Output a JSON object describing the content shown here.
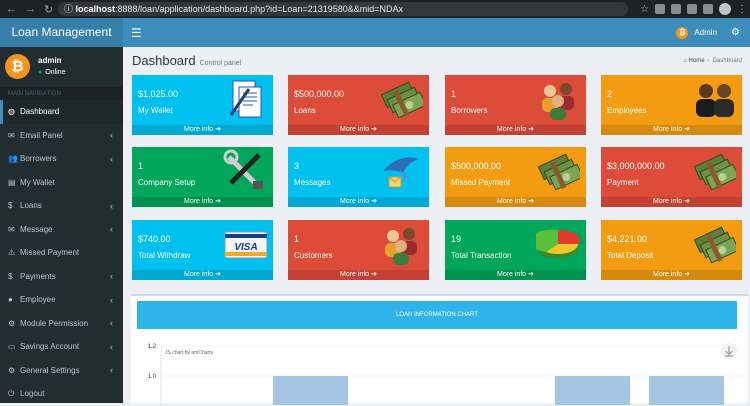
{
  "browser": {
    "url_host": "localhost",
    "url_rest": ":8888/loan/application/dashboard.php?id=Loan=21319580&&mid=NDAx"
  },
  "app": {
    "title": "Loan Management"
  },
  "topbar": {
    "user_name": "Admin",
    "coin_letter": "₿"
  },
  "sidebar": {
    "user": {
      "name": "admin",
      "status": "Online",
      "coin_letter": "₿"
    },
    "header": "MAIN NAVIGATION",
    "items": [
      {
        "label": "Dashboard",
        "icon": "dashboard-icon",
        "has_submenu": false,
        "active": true
      },
      {
        "label": "Email Panel",
        "icon": "envelope-icon",
        "has_submenu": true
      },
      {
        "label": "Borrowers",
        "icon": "users-icon",
        "has_submenu": true
      },
      {
        "label": "My Wallet",
        "icon": "wallet-icon",
        "has_submenu": false
      },
      {
        "label": "Loans",
        "icon": "dollar-icon",
        "has_submenu": true
      },
      {
        "label": "Message",
        "icon": "message-icon",
        "has_submenu": true
      },
      {
        "label": "Missed Payment",
        "icon": "warning-icon",
        "has_submenu": false
      },
      {
        "label": "Payments",
        "icon": "payment-icon",
        "has_submenu": true
      },
      {
        "label": "Employee",
        "icon": "user-icon",
        "has_submenu": true
      },
      {
        "label": "Module Permission",
        "icon": "gears-icon",
        "has_submenu": true
      },
      {
        "label": "Savings Account",
        "icon": "savings-icon",
        "has_submenu": true
      },
      {
        "label": "General Settings",
        "icon": "settings-icon",
        "has_submenu": true
      },
      {
        "label": "Logout",
        "icon": "logout-icon",
        "has_submenu": false
      }
    ]
  },
  "page": {
    "title": "Dashboard",
    "subtitle": "Control panel",
    "breadcrumb": {
      "home": "Home",
      "current": "Dashboard"
    }
  },
  "boxes": [
    {
      "value": "$1,025.00",
      "label": "My Wallet",
      "footer": "More info",
      "color": "aqua",
      "art": "document-icon"
    },
    {
      "value": "$500,000.00",
      "label": "Loans",
      "footer": "More info",
      "color": "red",
      "art": "money-icon"
    },
    {
      "value": "1",
      "label": "Borrowers",
      "footer": "More info",
      "color": "red",
      "art": "people-icon"
    },
    {
      "value": "2",
      "label": "Employees",
      "footer": "More info",
      "color": "orange",
      "art": "employees-icon"
    },
    {
      "value": "1",
      "label": "Company Setup",
      "footer": "More info",
      "color": "green",
      "art": "tools-icon"
    },
    {
      "value": "3",
      "label": "Messages",
      "footer": "More info",
      "color": "aqua",
      "art": "bird-mail-icon"
    },
    {
      "value": "$500,000.00",
      "label": "Missed Payment",
      "footer": "More info",
      "color": "orange",
      "art": "money-icon"
    },
    {
      "value": "$3,000,000.00",
      "label": "Payment",
      "footer": "More info",
      "color": "red",
      "art": "money-icon"
    },
    {
      "value": "$740.00",
      "label": "Total Withdraw",
      "footer": "More info",
      "color": "aqua",
      "art": "visa-card-icon",
      "art_text": "VISA"
    },
    {
      "value": "1",
      "label": "Customers",
      "footer": "More info",
      "color": "red",
      "art": "people-icon"
    },
    {
      "value": "19",
      "label": "Total Transaction",
      "footer": "More info",
      "color": "green",
      "art": "pie-chart-icon"
    },
    {
      "value": "$4,221.00",
      "label": "Total Deposit",
      "footer": "More info",
      "color": "orange",
      "art": "money-icon"
    }
  ],
  "chart": {
    "header": "LOAN INFORMATION CHART",
    "credit": "JS chart by amCharts",
    "download_icon": "download-icon"
  },
  "chart_data": {
    "type": "bar",
    "title": "",
    "xlabel": "",
    "ylabel": "",
    "y_ticks": [
      "1.2",
      "1.0"
    ],
    "ylim_visible": [
      1.0,
      1.2
    ],
    "note": "",
    "bars_visible": 3
  },
  "colors": {
    "aqua": "#00c0ef",
    "green": "#00a65a",
    "red": "#dd4b39",
    "orange": "#f39c12",
    "navbar": "#3c8dbc",
    "sidebar": "#222d32",
    "bars": "#a5c6e3"
  }
}
